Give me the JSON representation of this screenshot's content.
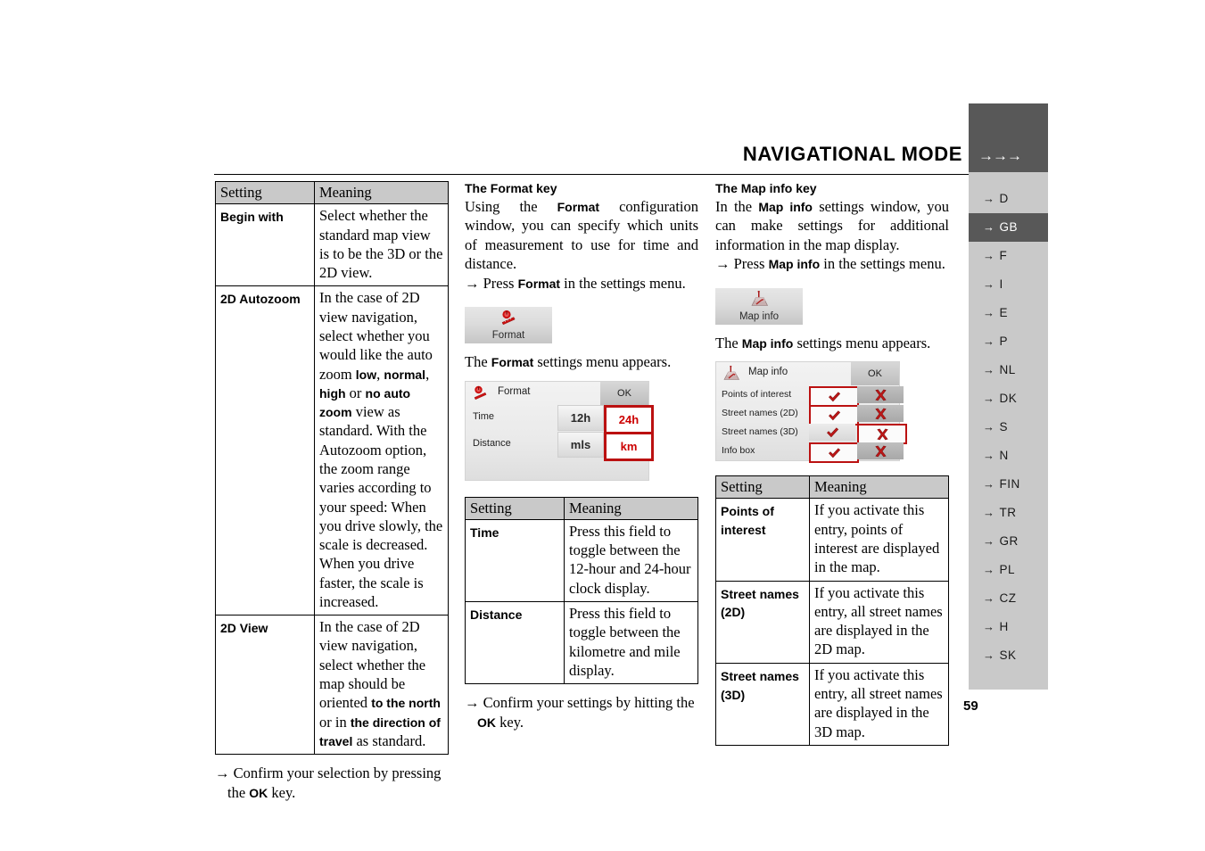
{
  "header": {
    "title": "NAVIGATIONAL MODE",
    "arrows": "→→→"
  },
  "sidebar": {
    "top_arrows": "→→→",
    "items": [
      {
        "label": "D",
        "active": false
      },
      {
        "label": "GB",
        "active": true
      },
      {
        "label": "F",
        "active": false
      },
      {
        "label": "I",
        "active": false
      },
      {
        "label": "E",
        "active": false
      },
      {
        "label": "P",
        "active": false
      },
      {
        "label": "NL",
        "active": false
      },
      {
        "label": "DK",
        "active": false
      },
      {
        "label": "S",
        "active": false
      },
      {
        "label": "N",
        "active": false
      },
      {
        "label": "FIN",
        "active": false
      },
      {
        "label": "TR",
        "active": false
      },
      {
        "label": "GR",
        "active": false
      },
      {
        "label": "PL",
        "active": false
      },
      {
        "label": "CZ",
        "active": false
      },
      {
        "label": "H",
        "active": false
      },
      {
        "label": "SK",
        "active": false
      }
    ],
    "arrow_glyph": "→",
    "active_color": "#585858",
    "list_bg": "#c9c9c9"
  },
  "page_number": "59",
  "column_left": {
    "table": {
      "headers": [
        "Setting",
        "Meaning"
      ],
      "rows": [
        {
          "setting": "Begin with",
          "meaning": "Select whether the standard map view is to be the 3D or the 2D view."
        },
        {
          "setting": "2D Autozoom",
          "meaning_part1": "In the case of 2D view navigation, select whether you would like the auto zoom ",
          "meaning_b1": "low",
          "meaning_part2": ", ",
          "meaning_b2": "normal",
          "meaning_part3": ", ",
          "meaning_b3": "high",
          "meaning_part4": " or ",
          "meaning_b4": "no auto zoom",
          "meaning_part5": " view as standard. With the Autozoom option, the zoom range varies according to your speed: When you drive slowly, the scale is decreased. When you drive faster, the scale is increased."
        },
        {
          "setting": "2D View",
          "meaning_part1": "In the case of 2D view navigation, select whether the map should be oriented ",
          "meaning_b1": "to the north",
          "meaning_part2": " or in ",
          "meaning_b2": "the direction of travel",
          "meaning_part3": " as standard."
        }
      ]
    },
    "confirm_part1": "→ Confirm your selection by pressing the ",
    "confirm_bold": "OK",
    "confirm_part2": " key."
  },
  "column_middle": {
    "sub_head": "The Format key",
    "intro_part1": "Using the ",
    "intro_bold1": "Format",
    "intro_part2": " configuration window, you can specify which units of measurement to use for time and distance.",
    "press_part1": "→ Press ",
    "press_bold": "Format",
    "press_part2": " in the settings menu.",
    "key_button": {
      "label": "Format",
      "icon": "clock-ruler-icon"
    },
    "appears_part1": "The ",
    "appears_bold": "Format",
    "appears_part2": " settings menu appears.",
    "panel": {
      "title": "Format",
      "title_icon": "clock-ruler-icon",
      "ok_label": "OK",
      "rows": [
        {
          "label": "Time",
          "option_left": "12h",
          "option_right": "24h",
          "selected": "right"
        },
        {
          "label": "Distance",
          "option_left": "mls",
          "option_right": "km",
          "selected": "right"
        }
      ]
    },
    "table": {
      "headers": [
        "Setting",
        "Meaning"
      ],
      "rows": [
        {
          "setting": "Time",
          "meaning": "Press this field to toggle between the 12-hour and 24-hour clock display."
        },
        {
          "setting": "Distance",
          "meaning": "Press this field to toggle between the kilometre and mile display."
        }
      ]
    },
    "confirm_part1": "→ Confirm your settings by hitting the ",
    "confirm_bold": "OK",
    "confirm_part2": " key."
  },
  "column_right": {
    "sub_head": "The Map info key",
    "intro_part1": "In the ",
    "intro_bold1": "Map info",
    "intro_part2": " settings window, you can make settings for additional information in the map display.",
    "press_part1": "→ Press ",
    "press_bold": "Map info",
    "press_part2": " in the settings menu.",
    "key_button": {
      "label": "Map info",
      "icon": "map-info-icon"
    },
    "appears_part1": "The ",
    "appears_bold": "Map info",
    "appears_part2": " settings menu appears.",
    "panel": {
      "title": "Map info",
      "title_icon": "map-info-icon",
      "ok_label": "OK",
      "rows": [
        {
          "label": "Points of interest",
          "selected": "yes"
        },
        {
          "label": "Street names (2D)",
          "selected": "yes"
        },
        {
          "label": "Street names (3D)",
          "selected": "no"
        },
        {
          "label": "Info box",
          "selected": "yes"
        }
      ],
      "yes_glyph": "check-icon",
      "no_glyph": "cross-icon"
    },
    "table": {
      "headers": [
        "Setting",
        "Meaning"
      ],
      "rows": [
        {
          "setting": "Points of interest",
          "meaning": "If you activate this entry, points of interest are displayed in the map."
        },
        {
          "setting": "Street names (2D)",
          "meaning": "If you activate this entry, all street names are displayed in the 2D map."
        },
        {
          "setting": "Street names (3D)",
          "meaning": "If you activate this entry, all street names are displayed in the 3D map."
        }
      ]
    }
  },
  "colors": {
    "accent_red": "#bb1111",
    "panel_red_text": "#cc0000",
    "table_header_gray": "#c9c9c9",
    "sidebar_dark": "#585858"
  }
}
